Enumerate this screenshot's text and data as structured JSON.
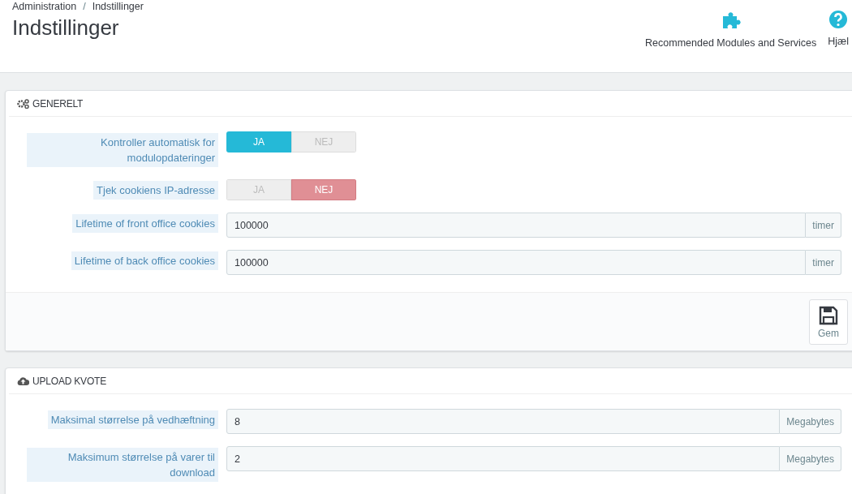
{
  "breadcrumb": [
    "Administration",
    "Indstillinger"
  ],
  "breadcrumb_separator": "/",
  "page_title": "Indstillinger",
  "toolbar": [
    {
      "label": "Recommended Modules and Services"
    },
    {
      "label": "Hjæl"
    }
  ],
  "panels": [
    {
      "title": "GENERELT",
      "fields": [
        {
          "kind": "toggle",
          "label": "Kontroller automatisk for modulopdateringer",
          "options": [
            {
              "label": "JA",
              "selected": true
            },
            {
              "label": "NEJ",
              "selected": false
            }
          ]
        },
        {
          "kind": "toggle",
          "label": "Tjek cookiens IP-adresse",
          "options": [
            {
              "label": "JA",
              "selected": false
            },
            {
              "label": "NEJ",
              "selected": true
            }
          ]
        },
        {
          "kind": "input",
          "label": "Lifetime of front office cookies",
          "value": "100000",
          "unit": "timer"
        },
        {
          "kind": "input",
          "label": "Lifetime of back office cookies",
          "value": "100000",
          "unit": "timer"
        }
      ],
      "save_button": "Gem"
    },
    {
      "title": "UPLOAD KVOTE",
      "fields": [
        {
          "kind": "input",
          "label": "Maksimal størrelse på vedhæftning",
          "value": "8",
          "unit": "Megabytes"
        },
        {
          "kind": "input",
          "label": "Maksimum størrelse på varer til download",
          "value": "2",
          "unit": "Megabytes"
        }
      ]
    }
  ]
}
